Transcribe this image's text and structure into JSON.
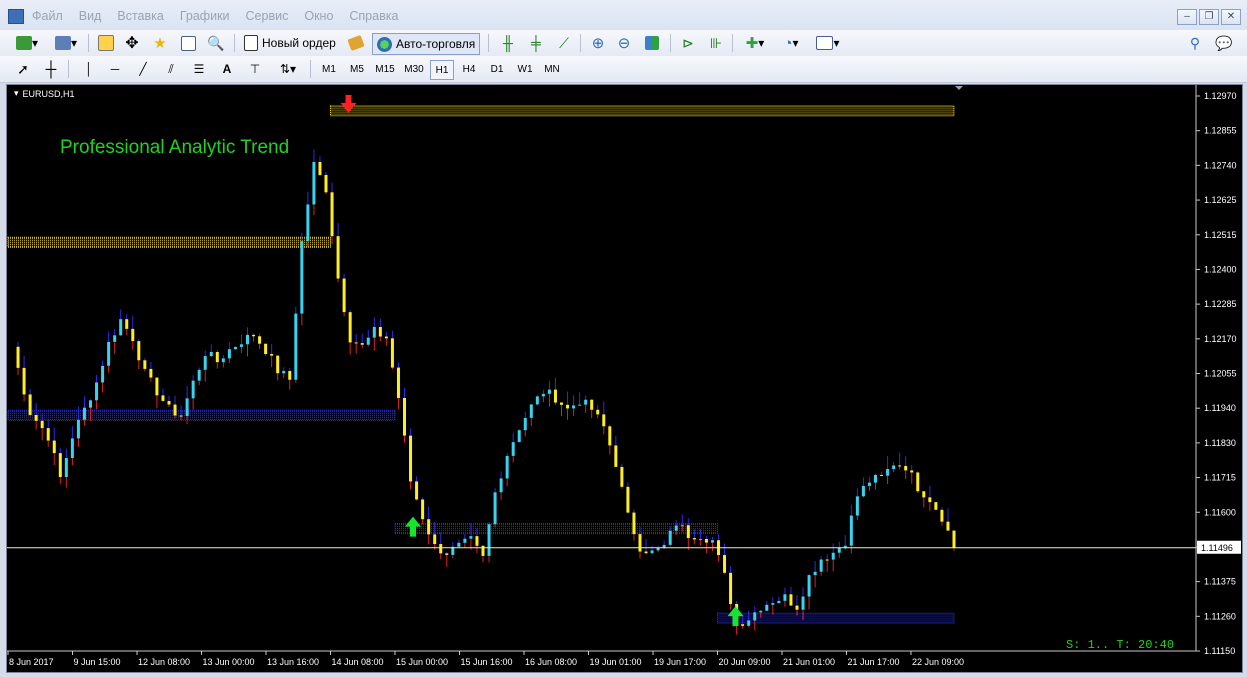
{
  "menu": [
    "Файл",
    "Вид",
    "Вставка",
    "Графики",
    "Сервис",
    "Окно",
    "Справка"
  ],
  "toolbar": {
    "new_order": "Новый ордер",
    "auto_trading": "Авто-торговля"
  },
  "drawing_tools": {
    "text_tool": "A"
  },
  "timeframes": [
    "M1",
    "M5",
    "M15",
    "M30",
    "H1",
    "H4",
    "D1",
    "W1",
    "MN"
  ],
  "active_timeframe": "H1",
  "chart": {
    "symbol_label": "EURUSD,H1",
    "indicator_label": "Professional Analytic Trend",
    "status_text": "S: 1.. T: 20:40",
    "current_price": "1.11496",
    "colors": {
      "bull": "#37d3f0",
      "bear": "#ffee22",
      "wick_up": "#2a2af0",
      "wick_down": "#e02020",
      "band_yellow": "#e8cf2a",
      "band_blue": "#2b2ed8",
      "arrow_up": "#17e52d",
      "arrow_down": "#ff2020",
      "indicator_text": "#1fd31f",
      "price_line": "#f2f2a8"
    }
  },
  "chart_data": {
    "type": "candlestick",
    "symbol": "EURUSD",
    "timeframe": "H1",
    "y_ticks": [
      "1.12970",
      "1.12855",
      "1.12740",
      "1.12625",
      "1.12515",
      "1.12400",
      "1.12285",
      "1.12170",
      "1.12055",
      "1.11940",
      "1.11830",
      "1.11715",
      "1.11600",
      "1.11485",
      "1.11375",
      "1.11260",
      "1.11150"
    ],
    "x_ticks": [
      "8 Jun 2017",
      "9 Jun 15:00",
      "12 Jun 08:00",
      "13 Jun 00:00",
      "13 Jun 16:00",
      "14 Jun 08:00",
      "15 Jun 00:00",
      "15 Jun 16:00",
      "16 Jun 08:00",
      "19 Jun 01:00",
      "19 Jun 17:00",
      "20 Jun 09:00",
      "21 Jun 01:00",
      "21 Jun 17:00",
      "22 Jun 09:00"
    ],
    "ylim": [
      1.1115,
      1.1301
    ],
    "last_price": 1.11496,
    "path": [
      [
        0,
        1.1217
      ],
      [
        3,
        1.1195
      ],
      [
        6,
        1.1187
      ],
      [
        8,
        1.1173
      ],
      [
        10,
        1.1187
      ],
      [
        12,
        1.1196
      ],
      [
        14,
        1.1205
      ],
      [
        16,
        1.1218
      ],
      [
        18,
        1.1226
      ],
      [
        20,
        1.122
      ],
      [
        22,
        1.1208
      ],
      [
        24,
        1.1202
      ],
      [
        26,
        1.1196
      ],
      [
        28,
        1.1194
      ],
      [
        30,
        1.1205
      ],
      [
        32,
        1.1215
      ],
      [
        34,
        1.1212
      ],
      [
        36,
        1.1216
      ],
      [
        38,
        1.1219
      ],
      [
        40,
        1.1221
      ],
      [
        42,
        1.1216
      ],
      [
        44,
        1.1209
      ],
      [
        46,
        1.1206
      ],
      [
        48,
        1.1252
      ],
      [
        50,
        1.1278
      ],
      [
        52,
        1.127
      ],
      [
        54,
        1.124
      ],
      [
        56,
        1.122
      ],
      [
        58,
        1.1217
      ],
      [
        60,
        1.1222
      ],
      [
        62,
        1.122
      ],
      [
        64,
        1.12
      ],
      [
        66,
        1.1172
      ],
      [
        68,
        1.116
      ],
      [
        70,
        1.115
      ],
      [
        72,
        1.1148
      ],
      [
        74,
        1.115
      ],
      [
        76,
        1.1152
      ],
      [
        78,
        1.1146
      ],
      [
        80,
        1.1168
      ],
      [
        82,
        1.1181
      ],
      [
        84,
        1.119
      ],
      [
        86,
        1.1197
      ],
      [
        88,
        1.1202
      ],
      [
        90,
        1.12
      ],
      [
        92,
        1.1196
      ],
      [
        94,
        1.1199
      ],
      [
        96,
        1.1196
      ],
      [
        98,
        1.119
      ],
      [
        100,
        1.1178
      ],
      [
        102,
        1.116
      ],
      [
        104,
        1.115
      ],
      [
        106,
        1.1148
      ],
      [
        108,
        1.115
      ],
      [
        110,
        1.1158
      ],
      [
        112,
        1.1154
      ],
      [
        114,
        1.1154
      ],
      [
        116,
        1.1152
      ],
      [
        118,
        1.114
      ],
      [
        120,
        1.1124
      ],
      [
        122,
        1.1126
      ],
      [
        124,
        1.113
      ],
      [
        126,
        1.1132
      ],
      [
        128,
        1.1133
      ],
      [
        130,
        1.113
      ],
      [
        132,
        1.114
      ],
      [
        134,
        1.1146
      ],
      [
        136,
        1.1148
      ],
      [
        138,
        1.1152
      ],
      [
        140,
        1.1167
      ],
      [
        142,
        1.1172
      ],
      [
        144,
        1.1173
      ],
      [
        146,
        1.1178
      ],
      [
        148,
        1.1177
      ],
      [
        150,
        1.117
      ],
      [
        152,
        1.1166
      ],
      [
        154,
        1.116
      ],
      [
        156,
        1.115
      ]
    ],
    "bands": [
      {
        "color": "yellow",
        "price": 1.1296,
        "from": "14 Jun 08:00",
        "to": "22 Jun 09:00"
      },
      {
        "color": "yellow",
        "price": 1.1252,
        "from": "8 Jun 2017",
        "to": "14 Jun 08:00"
      },
      {
        "color": "blue",
        "price": 1.1194,
        "from": "8 Jun 2017",
        "to": "15 Jun 00:00"
      },
      {
        "color": "blue",
        "price": 1.1156,
        "from": "15 Jun 00:00",
        "to": "20 Jun 09:00"
      },
      {
        "color": "blue",
        "price": 1.1126,
        "from": "20 Jun 09:00",
        "to": "22 Jun 09:00"
      }
    ],
    "signals": [
      {
        "type": "sell",
        "time": "14 Jun 08:00"
      },
      {
        "type": "buy",
        "time": "15 Jun 00:00"
      },
      {
        "type": "buy",
        "time": "20 Jun 09:00"
      }
    ]
  }
}
